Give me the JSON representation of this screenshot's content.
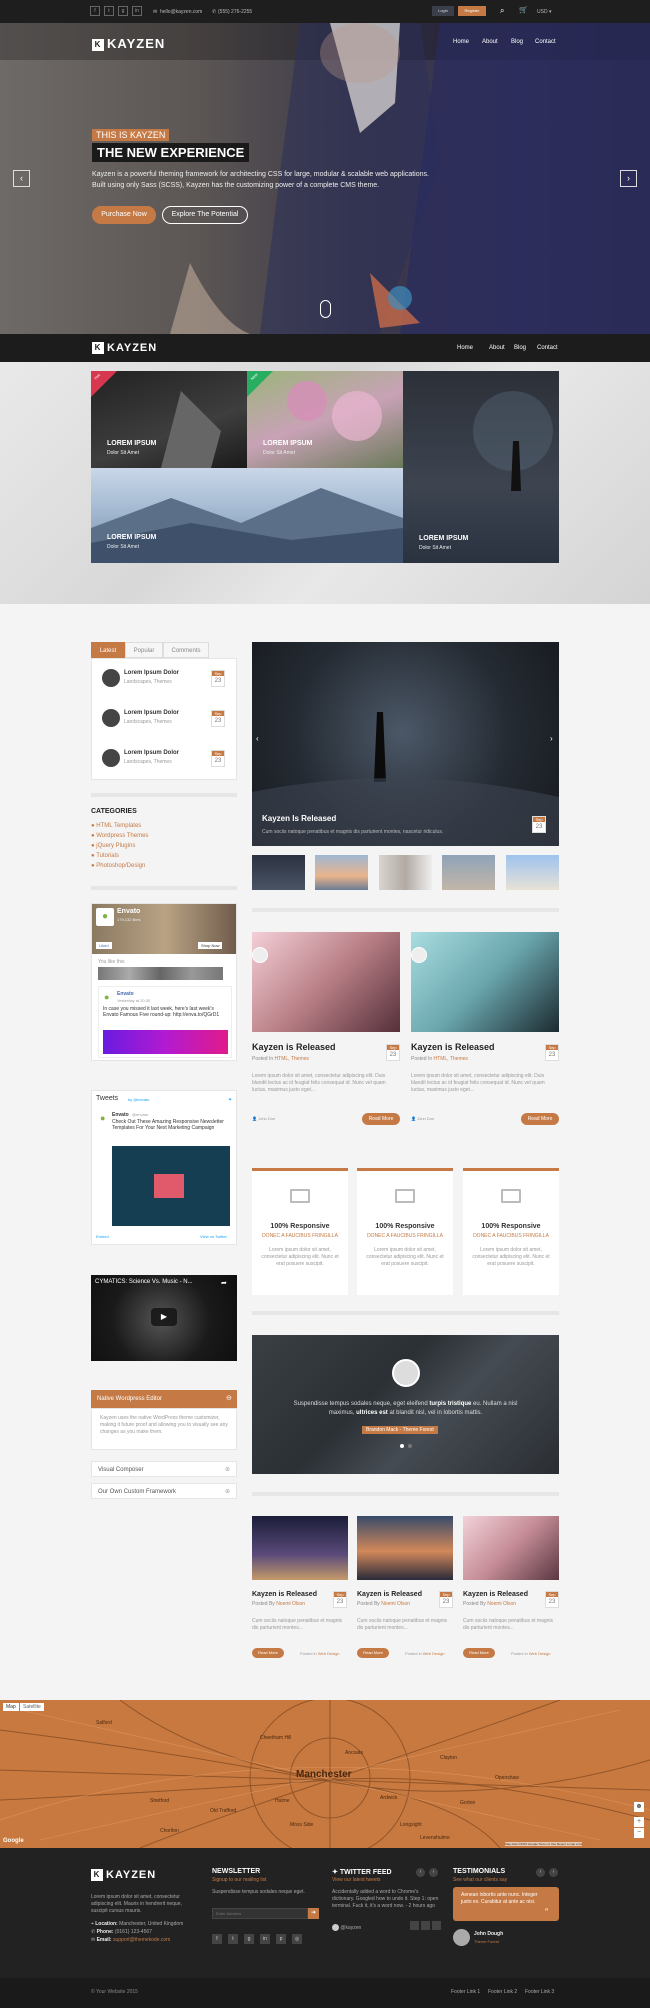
{
  "topbar": {
    "social_icons": [
      "facebook-icon",
      "twitter-icon",
      "google-plus-icon",
      "linkedin-icon"
    ],
    "email": "hello@kayzen.com",
    "phone": "(555) 276-2255",
    "login": "Login",
    "register": "Register",
    "currency": "USD"
  },
  "brand": {
    "logo_letter": "K",
    "name": "KAYZEN",
    "accent": "#c57a45"
  },
  "nav": {
    "items": [
      "Home",
      "About",
      "Blog",
      "Contact"
    ]
  },
  "hero": {
    "kicker": "THIS IS KAYZEN",
    "title": "THE NEW EXPERIENCE",
    "text": "Kayzen is a powerful theming framework for architecting CSS for large, modular & scalable web applications. Built using only Sass (SCSS), Kayzen has the customizing power of a complete CMS theme.",
    "primary_button": "Purchase Now",
    "secondary_button": "Explore The Potential"
  },
  "mosaic": {
    "tiles": [
      {
        "title": "LOREM IPSUM",
        "subtitle": "Dolor Sit Amet",
        "badge": "Hot"
      },
      {
        "title": "LOREM IPSUM",
        "subtitle": "Dolor Sit Amet",
        "badge": "New"
      },
      {
        "title": "LOREM IPSUM",
        "subtitle": "Dolor Sit Amet",
        "badge": ""
      },
      {
        "title": "LOREM IPSUM",
        "subtitle": "Dolor Sit Amet",
        "badge": ""
      }
    ]
  },
  "sidebar": {
    "tabs": [
      "Latest",
      "Popular",
      "Comments"
    ],
    "posts": [
      {
        "title": "Lorem Ipsum Dolor",
        "meta": "Landscapes, Themes",
        "month": "Sep",
        "day": "23"
      },
      {
        "title": "Lorem Ipsum Dolor",
        "meta": "Landscapes, Themes",
        "month": "Sep",
        "day": "23"
      },
      {
        "title": "Lorem Ipsum Dolor",
        "meta": "Landscapes, Themes",
        "month": "Sep",
        "day": "23"
      }
    ],
    "categories_title": "CATEGORIES",
    "categories": [
      "HTML Templates",
      "Wordpress Themes",
      "jQuery Plugins",
      "Tutorials",
      "Photoshop/Design"
    ],
    "fb": {
      "name": "Envato",
      "likes": "179,132 likes",
      "like_btn": "Liked",
      "shop_btn": "Shop Now",
      "friends": "You like this",
      "post_author": "Envato",
      "post_time": "Yesterday at 20:30",
      "post_text": "In case you missed it last week, here's last week's Envato Famous Five round-up: http://enva.to/QGrD1"
    },
    "tweets": {
      "title": "Tweets",
      "by": "by @envato",
      "author": "Envato",
      "handle": "@envato",
      "text": "Check Out These Amazing Responsive Newsletter Templates For Your Next Marketing Campaign",
      "embed": "Embed",
      "view": "View on Twitter"
    },
    "video": {
      "title": "CYMATICS: Science Vs. Music - N..."
    },
    "accordion": {
      "open_title": "Native Wordpress Editor",
      "open_text": "Kayzen uses the native WordPress theme customizer, making it future proof and allowing you to visually see any changes as you make them.",
      "items": [
        "Visual Composer",
        "Our Own Custom Framework"
      ]
    }
  },
  "slider": {
    "title": "Kayzen Is Released",
    "text": "Cum sociis natoque penatibus et magnis dis parturient montes, nascetur ridiculus.",
    "month": "Sep",
    "day": "23"
  },
  "posts_two": [
    {
      "title": "Kayzen is Released",
      "posted": "Posted In",
      "cats": "HTML, Themes",
      "text": "Lorem ipsum dolor sit amet, consectetur adipiscing elit. Duis blandit lectus ac id feugiat felis consequat id. Nunc vel quam luctus, maximus justo eget...",
      "author": "John Doe",
      "more": "Read More",
      "month": "Sep",
      "day": "23"
    },
    {
      "title": "Kayzen is Released",
      "posted": "Posted In",
      "cats": "HTML, Themes",
      "text": "Lorem ipsum dolor sit amet, consectetur adipiscing elit. Duis blandit lectus ac id feugiat felis consequat id. Nunc vel quam luctus, maximus justo eget...",
      "author": "John Doe",
      "more": "Read More",
      "month": "Sep",
      "day": "23"
    }
  ],
  "features": [
    {
      "title": "100% Responsive",
      "sub": "DONEC A FAUCIBUS FRINGILLA",
      "text": "Lorem ipsum dolor sit amet, consectetur adipiscing elit. Nunc et erat posuere suscipit."
    },
    {
      "title": "100% Responsive",
      "sub": "DONEC A FAUCIBUS FRINGILLA",
      "text": "Lorem ipsum dolor sit amet, consectetur adipiscing elit. Nunc et erat posuere suscipit."
    },
    {
      "title": "100% Responsive",
      "sub": "DONEC A FAUCIBUS FRINGILLA",
      "text": "Lorem ipsum dolor sit amet, consectetur adipiscing elit. Nunc et erat posuere suscipit."
    }
  ],
  "testimonial": {
    "text_a": "Suspendisse tempus sodales neque, eget eleifend",
    "text_b": "turpis tristique",
    "text_c": "eu. Nullam a nisl maximus,",
    "text_d": "ultrices est",
    "text_e": "at blandit nisl, vel in lobortis mattis.",
    "name": "Brandon Mack - Theme Forest"
  },
  "posts_three": [
    {
      "title": "Kayzen is Released",
      "posted": "Posted By",
      "author": "Noemi Olson",
      "text": "Cum sociis natoque penatibus et magnis dis parturient montes...",
      "more": "Read More",
      "posted_in": "Posted in",
      "cat": "Web Design",
      "month": "Sep",
      "day": "23"
    },
    {
      "title": "Kayzen is Released",
      "posted": "Posted By",
      "author": "Noemi Olson",
      "text": "Cum sociis natoque penatibus et magnis dis parturient montes...",
      "more": "Read More",
      "posted_in": "Posted in",
      "cat": "Web Design",
      "month": "Sep",
      "day": "23"
    },
    {
      "title": "Kayzen is Released",
      "posted": "Posted By",
      "author": "Noemi Olson",
      "text": "Cum sociis natoque penatibus et magnis dis parturient montes...",
      "more": "Read More",
      "posted_in": "Posted in",
      "cat": "Web Design",
      "month": "Sep",
      "day": "23"
    }
  ],
  "map": {
    "tab_map": "Map",
    "tab_sat": "Satellite",
    "city": "Manchester",
    "places": [
      "Salford",
      "Ancoats",
      "Hulme",
      "Moss Side",
      "Ardwick",
      "Longsight",
      "Gorton",
      "Clayton",
      "Openshaw",
      "Levenshulme",
      "Chorlton",
      "Stretford",
      "Old Trafford",
      "Cheetham Hill"
    ],
    "google": "Google",
    "terms": "Map data ©2015 Google   Terms of Use   Report a map error"
  },
  "footer": {
    "about": "Lorem ipsum dolor sit amet, consectetur adipiscing elit. Mauris in hendrerit neque, suscipit cursus mauris.",
    "location_label": "Location:",
    "location": "Manchester, United Kingdom",
    "phone_label": "Phone:",
    "phone": "(0161) 123-4567",
    "email_label": "Email:",
    "email": "support@themekode.com",
    "newsletter_title": "NEWSLETTER",
    "newsletter_sub": "Signup to our mailing list",
    "newsletter_text": "Suspendisse tempus sodales neque eget.",
    "newsletter_placeholder": "Enter Address",
    "twitter_title": "TWITTER FEED",
    "twitter_sub": "View our latest tweets",
    "twitter_text": "Accidentally added a word to Chrome's dictionary. Googled how to undo it. Step 1: open terminal. Fuck it, it's a word now. - 2 hours ago",
    "twitter_user": "@kayzen",
    "testimonials_title": "TESTIMONIALS",
    "testimonials_sub": "See what our clients say",
    "testimonial_text": "Aenean lobortis ante nunc. Integer justo ex. Curabitur at ante ac nisi.",
    "testimonial_name": "John Dough",
    "testimonial_role": "Theme Forest",
    "copyright": "© Your Website 2015",
    "links": [
      "Footer Link 1",
      "Footer Link 2",
      "Footer Link 3"
    ]
  }
}
